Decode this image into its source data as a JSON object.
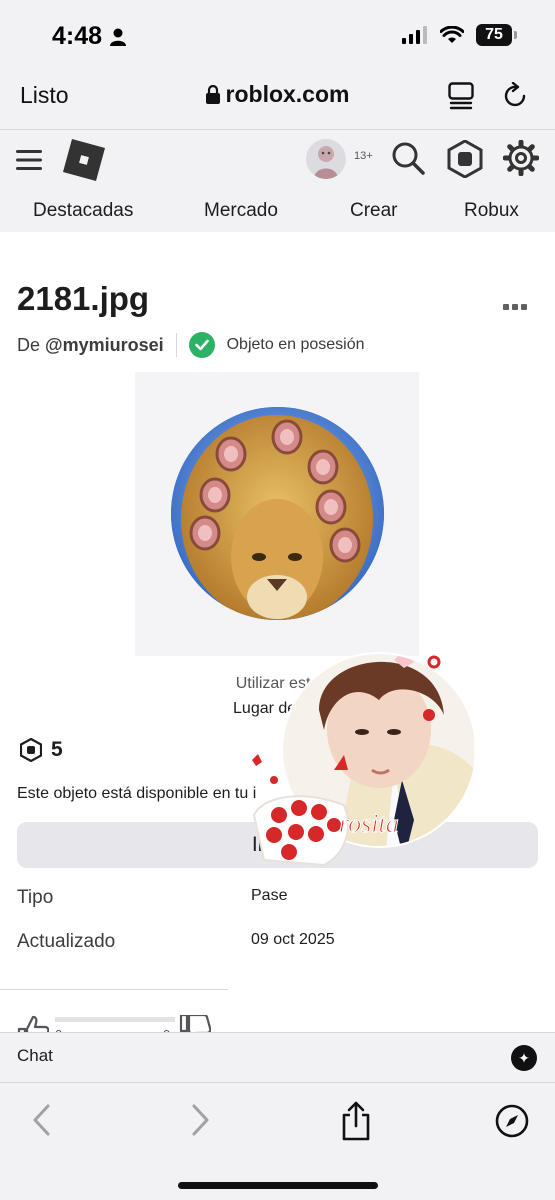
{
  "status_bar": {
    "time": "4:48",
    "battery": "75"
  },
  "browser": {
    "done_label": "Listo",
    "url": "roblox.com"
  },
  "header": {
    "age_badge": "13+",
    "nav": [
      {
        "label": "Destacadas"
      },
      {
        "label": "Mercado"
      },
      {
        "label": "Crear"
      },
      {
        "label": "Robux"
      }
    ]
  },
  "item": {
    "title": "2181.jpg",
    "by_prefix": "De",
    "creator": "@mymiurosei",
    "owned_label": "Objeto en posesión",
    "use_text": "Utilizar este",
    "place_text": "Lugar de my",
    "price": "5",
    "availability_text": "Este objeto está disponible en tu i",
    "inventory_button": "Inven",
    "details": [
      {
        "label": "Tipo",
        "value": "Pase"
      },
      {
        "label": "Actualizado",
        "value": "09 oct 2025"
      }
    ],
    "votes": {
      "up": "0",
      "down": "0"
    }
  },
  "sticker": {
    "caption": "rosita"
  },
  "chat": {
    "label": "Chat"
  },
  "colors": {
    "background": "#ffffff",
    "chrome": "#f2f2f5",
    "owned_green": "#2bb264",
    "button_gray": "#e7e7eb",
    "text": "#1d1d1f"
  },
  "icons": [
    "person-icon",
    "signal-icon",
    "wifi-icon",
    "lock-icon",
    "reader-icon",
    "reload-icon",
    "menu-icon",
    "roblox-logo",
    "search-icon",
    "robux-icon",
    "gear-icon",
    "more-icon",
    "check-icon",
    "thumbs-up-icon",
    "thumbs-down-icon",
    "chat-toggle-icon",
    "back-icon",
    "forward-icon",
    "share-icon",
    "compass-icon"
  ]
}
